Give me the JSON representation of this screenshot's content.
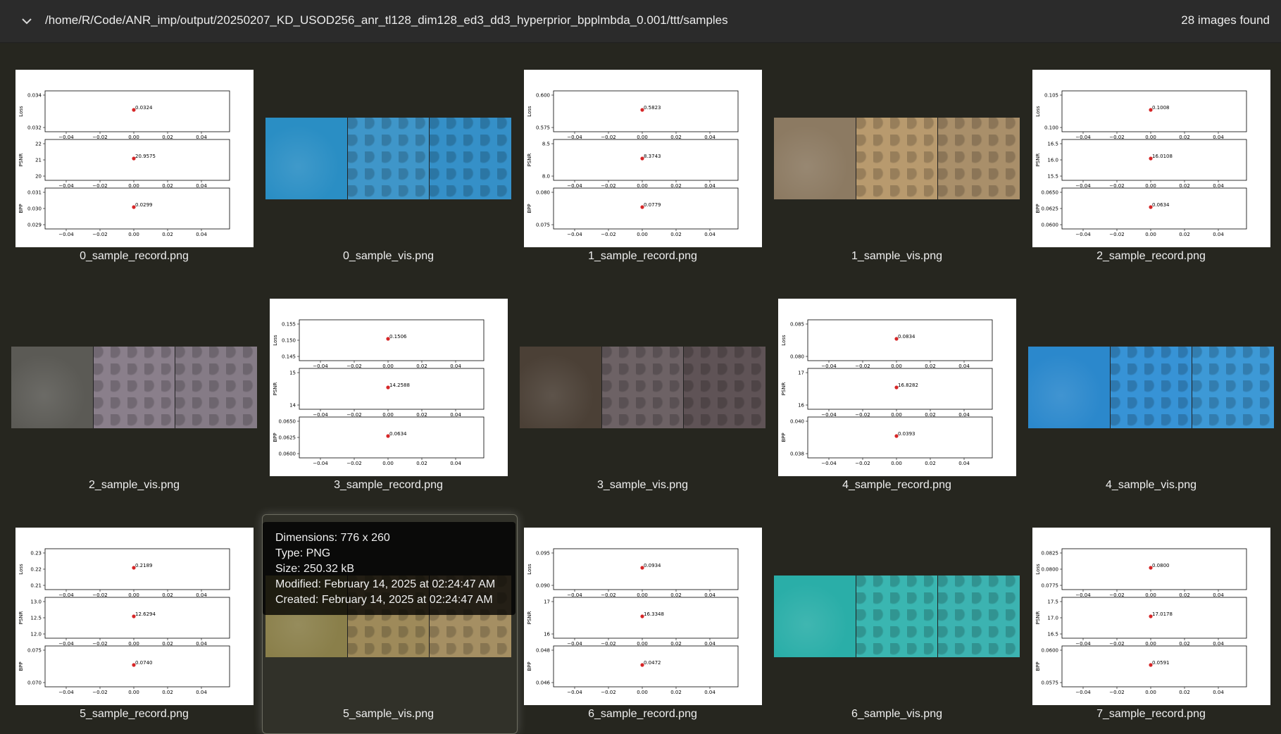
{
  "header": {
    "path": "/home/R/Code/ANR_imp/output/20250207_KD_USOD256_anr_tl128_dim128_ed3_dd3_hyperprior_bpplmbda_0.001/ttt/samples",
    "count_text": "28 images found"
  },
  "icons": {
    "collapse": "chevron-down-icon"
  },
  "colors": {
    "background": "#26261f",
    "header": "#2b2b2b",
    "marker": "#d62728"
  },
  "x_ticks": [
    "−0.04",
    "−0.02",
    "0.00",
    "0.02",
    "0.04"
  ],
  "row_labels": [
    "Loss",
    "PSNR",
    "BPP"
  ],
  "records": [
    {
      "file": "0_sample_record.png",
      "values": [
        "0.0324",
        "20.9575",
        "0.0299"
      ],
      "ticks": [
        [
          "0.034",
          "0.032"
        ],
        [
          "22",
          "21",
          "20"
        ],
        [
          "0.031",
          "0.030",
          "0.029"
        ]
      ]
    },
    {
      "file": "1_sample_record.png",
      "values": [
        "0.5823",
        "8.3743",
        "0.0779"
      ],
      "ticks": [
        [
          "0.600",
          "0.575"
        ],
        [
          "8.5",
          "8.0"
        ],
        [
          "0.080",
          "0.075"
        ]
      ]
    },
    {
      "file": "2_sample_record.png",
      "values": [
        "0.1008",
        "16.0108",
        "0.0634"
      ],
      "ticks": [
        [
          "0.105",
          "0.100"
        ],
        [
          "16.5",
          "16.0",
          "15.5"
        ],
        [
          "0.0650",
          "0.0625",
          "0.0600"
        ]
      ]
    },
    {
      "file": "3_sample_record.png",
      "values": [
        "0.1506",
        "14.2588",
        "0.0634"
      ],
      "ticks": [
        [
          "0.155",
          "0.150",
          "0.145"
        ],
        [
          "15",
          "14"
        ],
        [
          "0.0650",
          "0.0625",
          "0.0600"
        ]
      ]
    },
    {
      "file": "4_sample_record.png",
      "values": [
        "0.0834",
        "16.8282",
        "0.0393"
      ],
      "ticks": [
        [
          "0.085",
          "0.080"
        ],
        [
          "17",
          "16"
        ],
        [
          "0.040",
          "0.038"
        ]
      ]
    },
    {
      "file": "5_sample_record.png",
      "values": [
        "0.2189",
        "12.6294",
        "0.0740"
      ],
      "ticks": [
        [
          "0.23",
          "0.22",
          "0.21"
        ],
        [
          "13.0",
          "12.5",
          "12.0"
        ],
        [
          "0.075",
          "0.070"
        ]
      ]
    },
    {
      "file": "6_sample_record.png",
      "values": [
        "0.0934",
        "16.3348",
        "0.0472"
      ],
      "ticks": [
        [
          "0.095",
          "0.090"
        ],
        [
          "17",
          "16"
        ],
        [
          "0.048",
          "0.046"
        ]
      ]
    },
    {
      "file": "7_sample_record.png",
      "values": [
        "0.0800",
        "17.0178",
        "0.0591"
      ],
      "ticks": [
        [
          "0.0825",
          "0.0800",
          "0.0775"
        ],
        [
          "17.5",
          "17.0",
          "16.5"
        ],
        [
          "0.0600",
          "0.0575"
        ]
      ]
    }
  ],
  "visuals": [
    {
      "file": "0_sample_vis.png",
      "colors": [
        "#2a8ec4",
        "#3f96c9",
        "#3590c8"
      ]
    },
    {
      "file": "1_sample_vis.png",
      "colors": [
        "#8c7a62",
        "#b89a6e",
        "#a98f6a"
      ]
    },
    {
      "file": "2_sample_vis.png",
      "colors": [
        "#5b5a55",
        "#8a7f8b",
        "#857b86"
      ]
    },
    {
      "file": "3_sample_vis.png",
      "colors": [
        "#4b4036",
        "#6d6265",
        "#5f5356"
      ]
    },
    {
      "file": "4_sample_vis.png",
      "colors": [
        "#2b88cc",
        "#3793d6",
        "#3d99d6"
      ]
    },
    {
      "file": "5_sample_vis.png",
      "colors": [
        "#8a7f4a",
        "#9e8a5a",
        "#a58f63"
      ]
    },
    {
      "file": "6_sample_vis.png",
      "colors": [
        "#2aaea8",
        "#3ab6b1",
        "#3cb3b1"
      ]
    }
  ],
  "tooltip": {
    "dimensions": "Dimensions: 776 x 260",
    "type": "Type: PNG",
    "size": "Size: 250.32 kB",
    "modified": "Modified: February 14, 2025 at 02:24:47 AM",
    "created": "Created: February 14, 2025 at 02:24:47 AM"
  }
}
